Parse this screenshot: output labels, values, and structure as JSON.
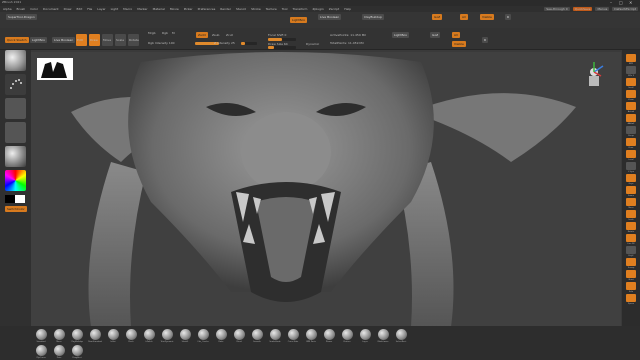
{
  "app": {
    "title": "ZBrush 2021",
    "window_controls": [
      "–",
      "□",
      "✕"
    ]
  },
  "menu": {
    "items": [
      "Alpha",
      "Brush",
      "Color",
      "Document",
      "Draw",
      "Edit",
      "File",
      "Layer",
      "Light",
      "Macro",
      "Marker",
      "Material",
      "Movie",
      "Picker",
      "Preferences",
      "Render",
      "Stencil",
      "Stroke",
      "Texture",
      "Tool",
      "Transform",
      "Zplugin",
      "Zscript",
      "Help"
    ],
    "quicksave": "QuickSave",
    "see_through": "See-through 0",
    "menus": "Menus",
    "default_script": "DefaultZScript"
  },
  "shelf": {
    "brush_name": "ClayBuildup",
    "mrgb": "Mrgb",
    "rgb": "Rgb",
    "m": "M",
    "zadd": "Zadd",
    "zsub": "Zsub",
    "zcut": "Zcut",
    "rgb_intensity_label": "Rgb Intensity 100",
    "z_intensity_label": "Z Intensity 25",
    "focal_shift_label": "Focal Shift 0",
    "draw_size_label": "Draw Size 64",
    "dynamic": "Dynamic",
    "active_points": "ActivePoints: 11.459 Mil",
    "total_points": "TotalPoints: 11.459 Mil",
    "edit": "Edit",
    "draw": "Draw",
    "move": "Move",
    "scale": "Scale",
    "rotate": "Rotate",
    "lightbox": "LightBox",
    "live_boolean": "Live Boolean",
    "goz": "GoZ",
    "all": "All",
    "visible": "Visible",
    "r": "R"
  },
  "left": {
    "tool_label": "SuperTool-Dragon",
    "quick_sketch": "Quick Sketch",
    "alpha_off": "Alpha Off",
    "texture_off": "Texture Off",
    "gradient": "Gradient",
    "switch_color": "SwitchColor",
    "alternate": "Alternate"
  },
  "right": {
    "items": [
      "BPR",
      "SPix 3",
      "Scroll",
      "Zoom",
      "Actual",
      "AAHalf",
      "Persp",
      "Floor",
      "Local",
      "L.Sym",
      "Gxyz",
      "Frame",
      "Move",
      "Scale",
      "Rotate",
      "Line Fill",
      "PolyF",
      "Transp",
      "Ghost",
      "Solo",
      "Xpose"
    ]
  },
  "brushes": {
    "items": [
      "Standard",
      "Move",
      "ClayBuildup",
      "DamStandard",
      "Inflat",
      "Pinch",
      "hPolish",
      "TrimDynamic",
      "Slash3",
      "Orb_Cracks",
      "Rake",
      "Chisel",
      "Smooth",
      "SnakeHook",
      "CurveTube",
      "IMM Parts",
      "Planar",
      "Flatten",
      "Layer",
      "MaskLasso",
      "SelectRect",
      "ClipCurve",
      "Dots",
      "DragRect"
    ]
  },
  "colors": {
    "accent": "#e07f20",
    "panel": "#333333",
    "canvas": "#404040"
  },
  "icons": {
    "gizmo": "navigation-gizmo-icon",
    "thumbnail": "dragon-thumbnail-icon"
  }
}
